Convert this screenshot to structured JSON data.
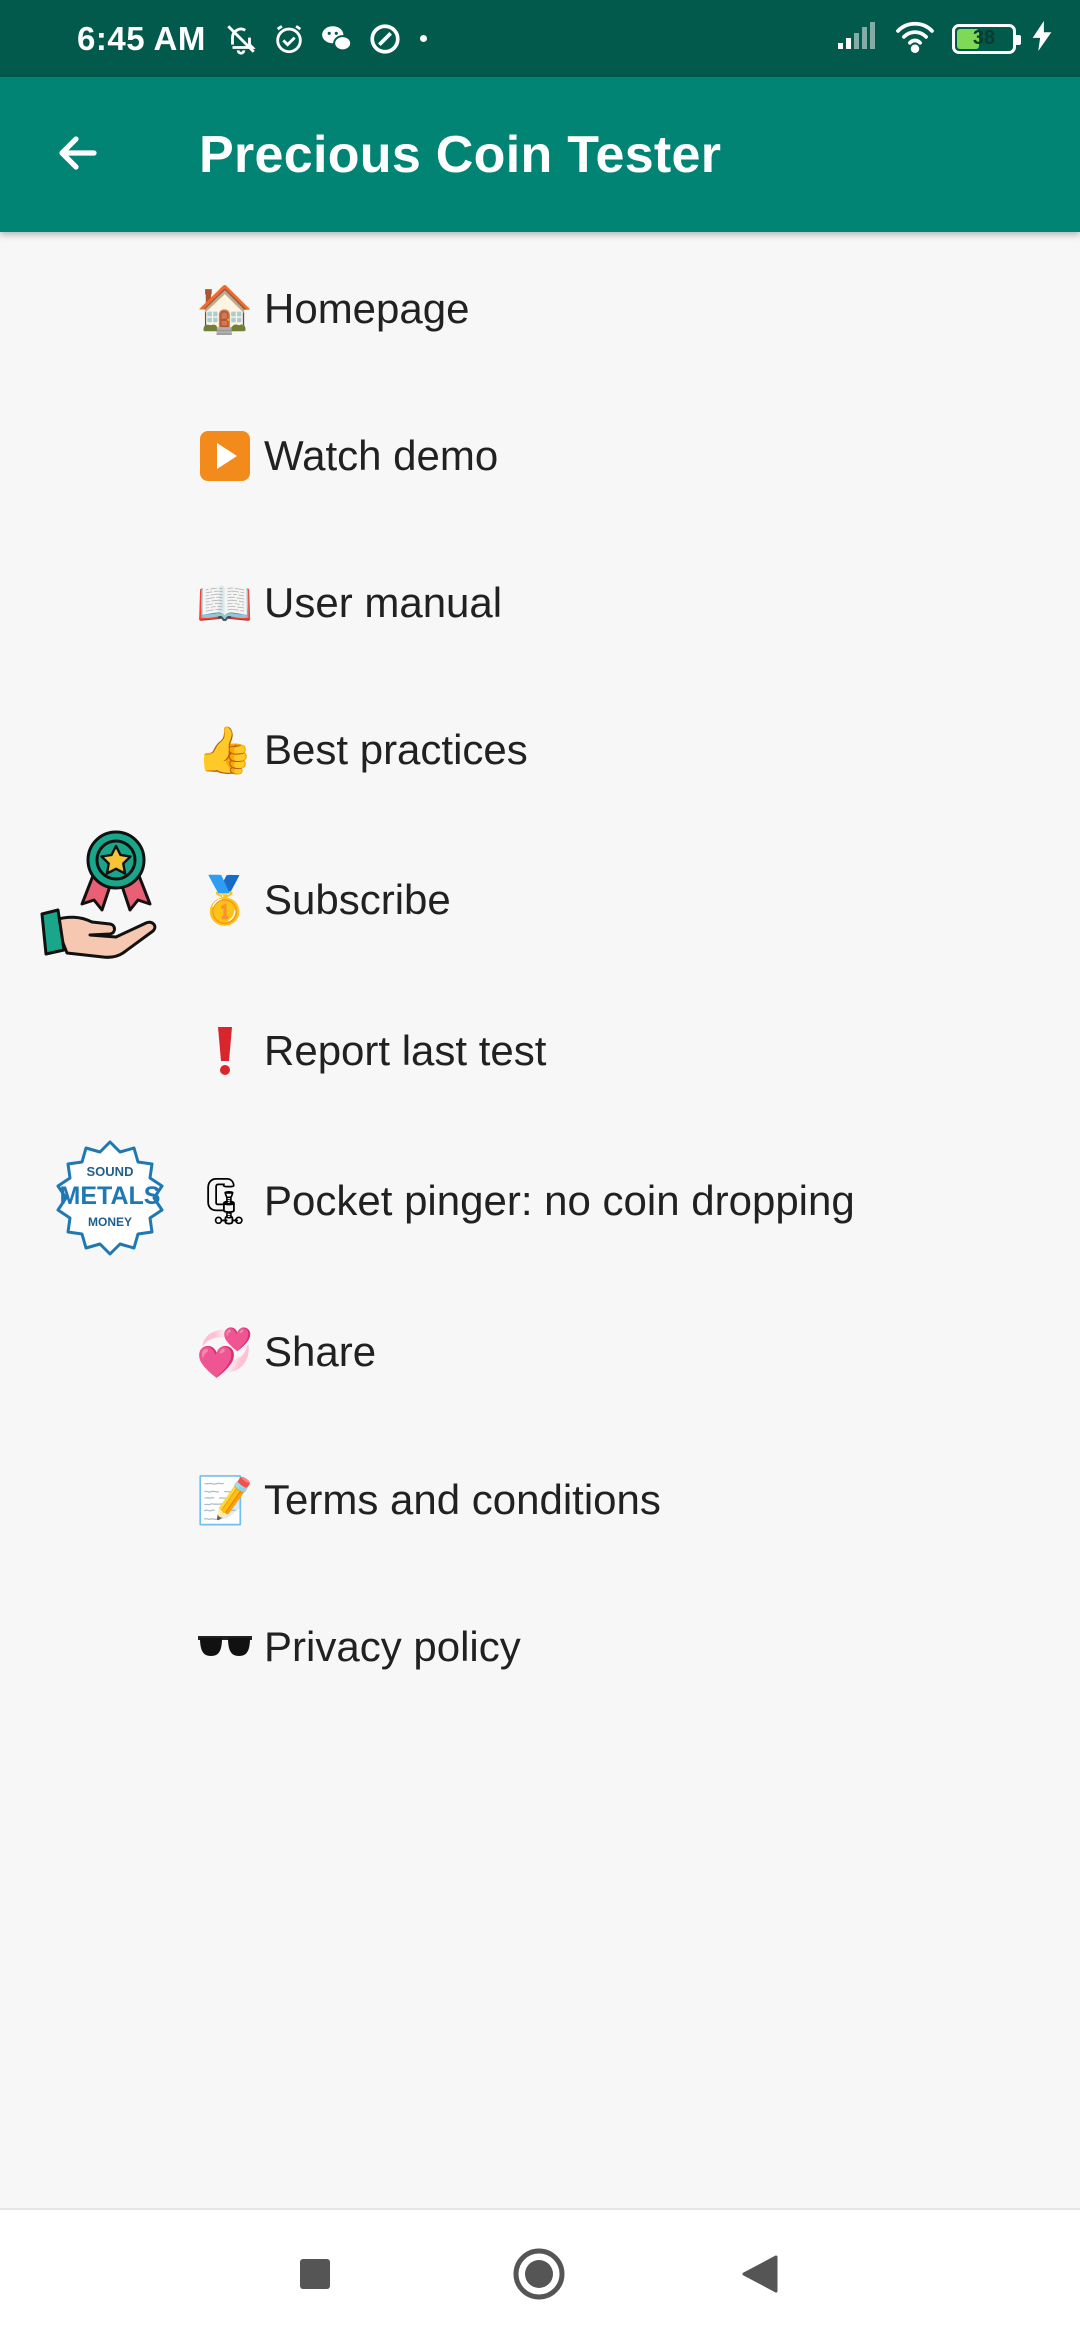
{
  "status_bar": {
    "time": "6:45 AM",
    "battery_level": "38",
    "battery_fraction": 0.38,
    "icons": [
      "mute-notifications-icon",
      "alarm-icon",
      "wechat-icon",
      "at-sign-icon",
      "signal-icon",
      "wifi-icon",
      "battery-icon",
      "charging-icon"
    ]
  },
  "app_bar": {
    "title": "Precious Coin Tester",
    "back_icon": "arrow-left-icon",
    "background": "#028474",
    "status_background": "#025a4c"
  },
  "menu": {
    "items": [
      {
        "emoji": "🏠",
        "label": "Homepage"
      },
      {
        "emoji": "▶",
        "label": "Watch demo"
      },
      {
        "emoji": "📖",
        "label": "User manual"
      },
      {
        "emoji": "👍",
        "label": "Best practices"
      },
      {
        "emoji": "🥇",
        "label": "Subscribe"
      },
      {
        "emoji": "❗",
        "label": "Report last test"
      },
      {
        "emoji": "🗜",
        "label": "Pocket pinger: no coin dropping"
      },
      {
        "emoji": "💞",
        "label": "Share"
      },
      {
        "emoji": "📝",
        "label": "Terms and conditions"
      },
      {
        "emoji": "🕶",
        "label": "Privacy policy"
      }
    ],
    "side_art": {
      "subscribe_badge": "hand-holding-medal-icon",
      "metals_badge": {
        "top": "SOUND",
        "middle": "METALS",
        "bottom": "MONEY"
      }
    }
  },
  "nav_bar": {
    "icons": [
      "recents-square-icon",
      "home-circle-icon",
      "back-triangle-icon"
    ]
  }
}
